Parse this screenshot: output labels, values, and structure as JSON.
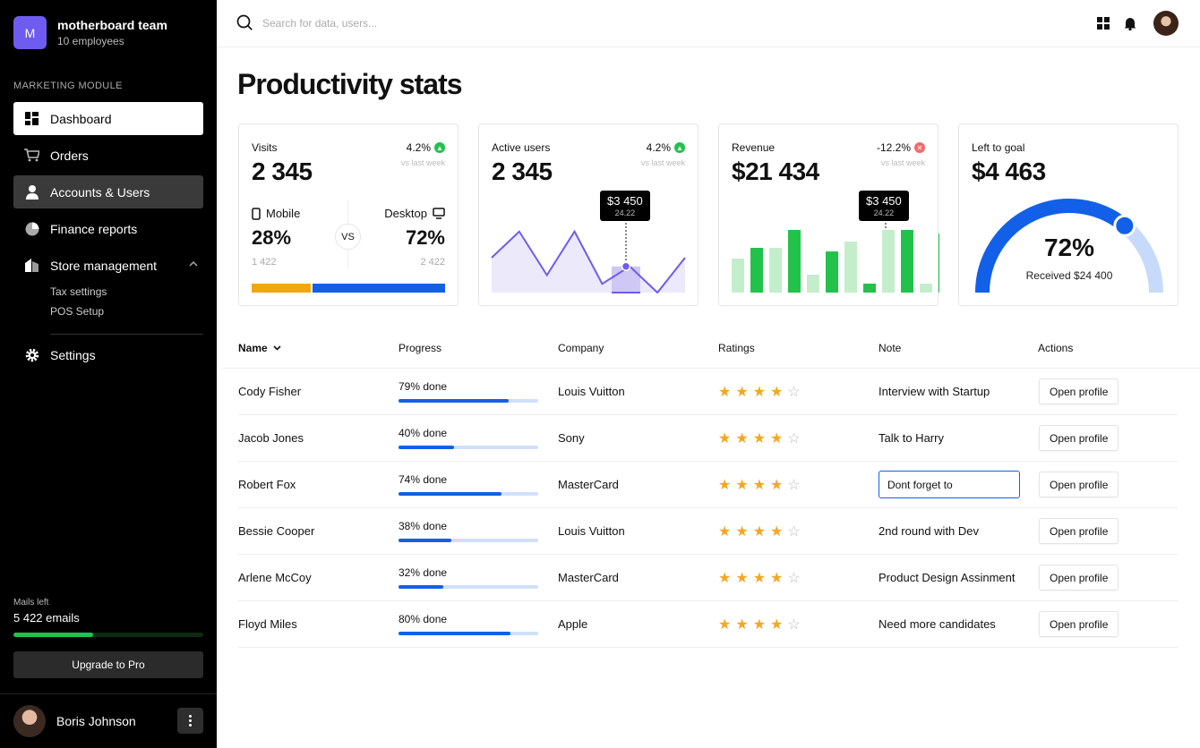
{
  "team": {
    "initial": "M",
    "name": "motherboard team",
    "sub": "10 employees"
  },
  "sidebar": {
    "module_label": "MARKETING MODULE",
    "items": [
      {
        "label": "Dashboard",
        "icon": "dashboard-icon"
      },
      {
        "label": "Orders",
        "icon": "cart-icon"
      },
      {
        "label": "Accounts & Users",
        "icon": "user-icon"
      },
      {
        "label": "Finance reports",
        "icon": "pie-icon"
      },
      {
        "label": "Store management",
        "icon": "store-icon"
      }
    ],
    "sub_items": [
      "Tax settings",
      "POS Setup"
    ],
    "settings_label": "Settings",
    "mails_label": "Mails left",
    "mails_value": "5 422 emails",
    "mails_progress": 0.42,
    "upgrade_label": "Upgrade to Pro",
    "user_name": "Boris Johnson"
  },
  "search": {
    "placeholder": "Search for data, users..."
  },
  "page_title": "Productivity stats",
  "cards": {
    "visits": {
      "label": "Visits",
      "value": "2 345",
      "delta": "4.2%",
      "delta_sub": "vs last week",
      "mobile_label": "Mobile",
      "mobile_pct": "28%",
      "mobile_count": "1 422",
      "desktop_label": "Desktop",
      "desktop_pct": "72%",
      "desktop_count": "2 422",
      "vs": "VS",
      "mobile_share": 0.31
    },
    "active": {
      "label": "Active users",
      "value": "2 345",
      "delta": "4.2%",
      "delta_sub": "vs last week",
      "tooltip_value": "$3 450",
      "tooltip_sub": "24.22",
      "series": [
        40,
        70,
        20,
        70,
        10,
        30,
        0,
        40
      ]
    },
    "revenue": {
      "label": "Revenue",
      "value": "$21 434",
      "delta": "-12.2%",
      "delta_sub": "vs last week",
      "tooltip_value": "$3 450",
      "tooltip_sub": "24.22",
      "bars": [
        {
          "v": 38,
          "emph": false
        },
        {
          "v": 50,
          "emph": true
        },
        {
          "v": 50,
          "emph": false
        },
        {
          "v": 70,
          "emph": true
        },
        {
          "v": 20,
          "emph": false
        },
        {
          "v": 46,
          "emph": true
        },
        {
          "v": 57,
          "emph": false
        },
        {
          "v": 10,
          "emph": true
        },
        {
          "v": 70,
          "emph": false
        },
        {
          "v": 70,
          "emph": true
        },
        {
          "v": 10,
          "emph": false
        },
        {
          "v": 66,
          "emph": true
        }
      ]
    },
    "goal": {
      "label": "Left to goal",
      "value": "$4 463",
      "pct": "72%",
      "pct_value": 0.72,
      "sub": "Received $24 400"
    }
  },
  "colors": {
    "accent_blue": "#1260e8",
    "accent_purple": "#6e5bf0",
    "green": "#22c24a",
    "light_green": "#c4eecb",
    "orange": "#f5a60f",
    "red": "#f06a6a",
    "gauge_light": "#c7dafb"
  },
  "table": {
    "headers": [
      "Name",
      "Progress",
      "Company",
      "Ratings",
      "Note",
      "Actions"
    ],
    "rows": [
      {
        "name": "Cody Fisher",
        "progress_label": "79% done",
        "progress": 0.79,
        "company": "Louis Vuitton",
        "rating": 4,
        "note": "Interview with Startup",
        "action": "Open profile"
      },
      {
        "name": "Jacob Jones",
        "progress_label": "40% done",
        "progress": 0.4,
        "company": "Sony",
        "rating": 4,
        "note": "Talk to Harry",
        "action": "Open profile"
      },
      {
        "name": "Robert Fox",
        "progress_label": "74% done",
        "progress": 0.74,
        "company": "MasterCard",
        "rating": 4,
        "note": "Dont forget to",
        "editing": true,
        "action": "Open profile"
      },
      {
        "name": "Bessie Cooper",
        "progress_label": "38% done",
        "progress": 0.38,
        "company": "Louis Vuitton",
        "rating": 4,
        "note": "2nd round with Dev",
        "action": "Open profile"
      },
      {
        "name": "Arlene McCoy",
        "progress_label": "32% done",
        "progress": 0.32,
        "company": "MasterCard",
        "rating": 4,
        "note": "Product Design Assinment",
        "action": "Open profile"
      },
      {
        "name": "Floyd Miles",
        "progress_label": "80% done",
        "progress": 0.8,
        "company": "Apple",
        "rating": 4,
        "note": "Need more candidates",
        "action": "Open profile"
      }
    ]
  }
}
